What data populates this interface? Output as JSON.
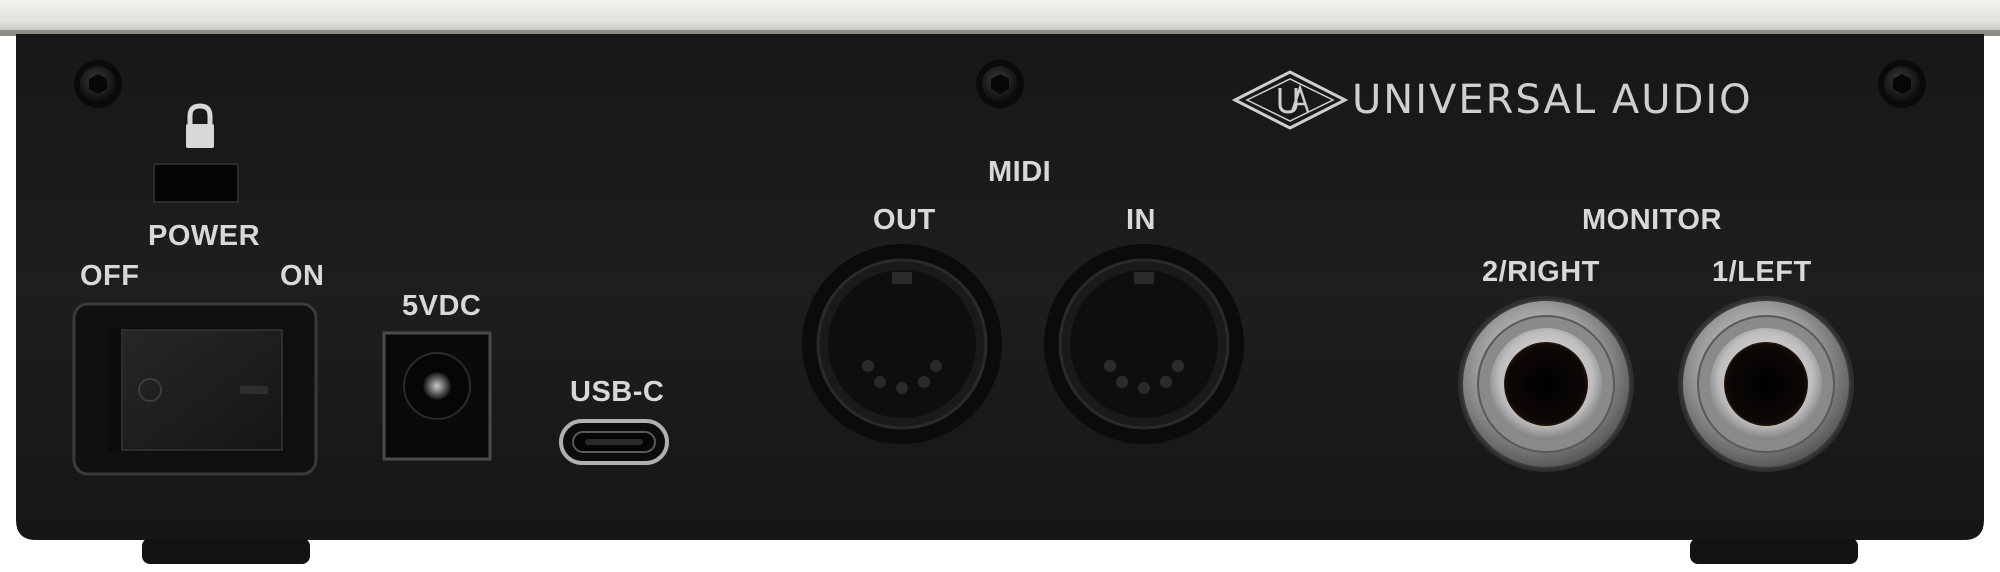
{
  "brand": {
    "name": "UNIVERSAL AUDIO",
    "logo_letters": "UA"
  },
  "panel_labels": {
    "power": "POWER",
    "off": "OFF",
    "on": "ON",
    "dc_input": "5VDC",
    "usb": "USB-C",
    "midi": "MIDI",
    "midi_out": "OUT",
    "midi_in": "IN",
    "monitor": "MONITOR",
    "monitor_right": "2/RIGHT",
    "monitor_left": "1/LEFT"
  },
  "icons": {
    "lock": "lock-icon",
    "screw": "screw-icon"
  },
  "colors": {
    "panel": "#1c1d1e",
    "top_trim": "#e6e4df",
    "label_text": "#d8d8d8",
    "metal": "#b8b8b8"
  }
}
